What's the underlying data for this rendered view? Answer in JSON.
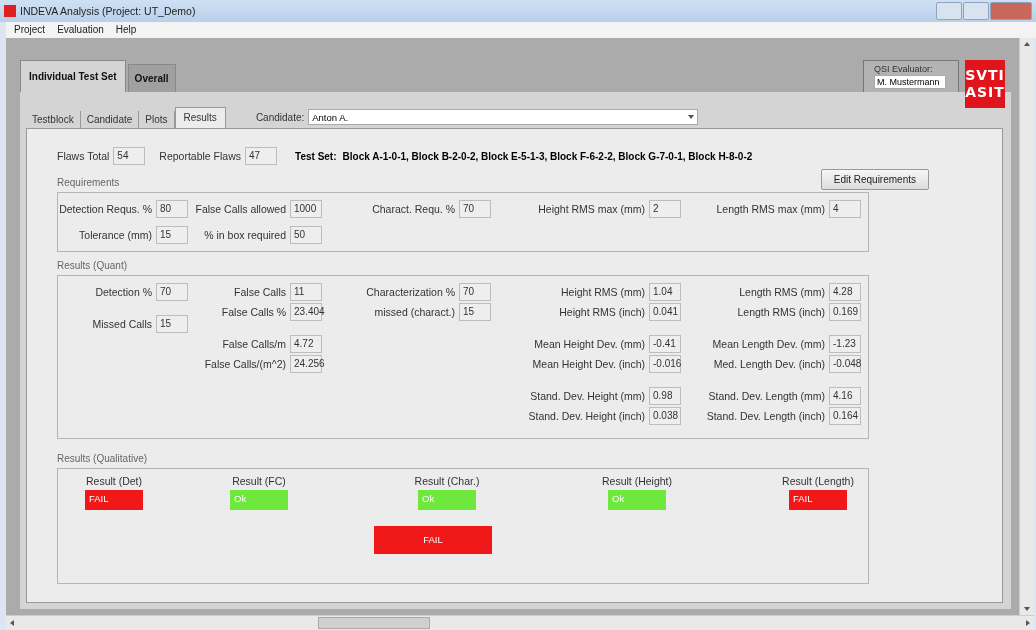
{
  "window": {
    "title": "INDEVA Analysis (Project: UT_Demo)"
  },
  "menu": [
    "Project",
    "Evaluation",
    "Help"
  ],
  "main_tabs": [
    {
      "label": "Individual Test Set",
      "selected": true
    },
    {
      "label": "Overall",
      "selected": false
    }
  ],
  "evaluator": {
    "label": "QSI Evaluator:",
    "value": "M. Mustermann"
  },
  "logo": [
    "SVTI",
    "ASIT"
  ],
  "sub_tabs": [
    {
      "label": "Testblock",
      "selected": false
    },
    {
      "label": "Candidate",
      "selected": false
    },
    {
      "label": "Plots",
      "selected": false
    },
    {
      "label": "Results",
      "selected": true
    }
  ],
  "candidate": {
    "label": "Candidate:",
    "value": "Anton A."
  },
  "flaws": [
    {
      "label": "Flaws Total",
      "value": "54"
    },
    {
      "label": "Reportable Flaws",
      "value": "47"
    }
  ],
  "test_set": {
    "label": "Test Set:",
    "value": "Block A-1-0-1, Block B-2-0-2, Block E-5-1-3, Block F-6-2-2, Block G-7-0-1, Block H-8-0-2"
  },
  "edit_button": "Edit Requirements",
  "requirements": {
    "title": "Requirements",
    "columns": [
      [
        [
          {
            "label": "Detection Requs. %",
            "value": "80"
          }
        ],
        [
          {
            "label": "Tolerance (mm)",
            "value": "15"
          }
        ]
      ],
      [
        [
          {
            "label": "False Calls  allowed",
            "value": "1000"
          }
        ],
        [
          {
            "label": "% in box required",
            "value": "50"
          }
        ]
      ],
      [
        [
          {
            "label": "Charact. Requ. %",
            "value": "70"
          }
        ]
      ],
      [
        [
          {
            "label": "Height RMS max (mm)",
            "value": "2"
          }
        ]
      ],
      [
        [
          {
            "label": "Length RMS max (mm)",
            "value": "4"
          }
        ]
      ]
    ]
  },
  "quant": {
    "title": "Results (Quant)",
    "columns": [
      [
        [
          {
            "label": "Detection %",
            "value": "70"
          }
        ],
        [
          {
            "label": "Missed Calls",
            "value": "15"
          }
        ]
      ],
      [
        [
          {
            "label": "False Calls",
            "value": "11"
          },
          {
            "label": "False Calls %",
            "value": "23.404"
          }
        ],
        [
          {
            "label": "False Calls/m",
            "value": "4.72"
          },
          {
            "label": "False Calls/(m^2)",
            "value": "24.256"
          }
        ]
      ],
      [
        [
          {
            "label": "Characterization %",
            "value": "70"
          },
          {
            "label": "missed (charact.)",
            "value": "15"
          }
        ]
      ],
      [
        [
          {
            "label": "Height RMS (mm)",
            "value": "1.04"
          },
          {
            "label": "Height RMS (inch)",
            "value": "0.041"
          }
        ],
        [
          {
            "label": "Mean Height Dev. (mm)",
            "value": "-0.41"
          },
          {
            "label": "Mean Height Dev. (inch)",
            "value": "-0.016"
          }
        ],
        [
          {
            "label": "Stand. Dev. Height (mm)",
            "value": "0.98"
          },
          {
            "label": "Stand. Dev. Height (inch)",
            "value": "0.038"
          }
        ]
      ],
      [
        [
          {
            "label": "Length RMS (mm)",
            "value": "4.28"
          },
          {
            "label": "Length RMS (inch)",
            "value": "0.169"
          }
        ],
        [
          {
            "label": "Mean Length Dev. (mm)",
            "value": "-1.23"
          },
          {
            "label": "Med. Length Dev. (inch)",
            "value": "-0.048"
          }
        ],
        [
          {
            "label": "Stand. Dev. Length (mm)",
            "value": "4.16"
          },
          {
            "label": "Stand. Dev. Length (inch)",
            "value": "0.164"
          }
        ]
      ]
    ]
  },
  "qualitative": {
    "title": "Results (Qualitative)",
    "results": [
      {
        "label": "Result (Det)",
        "value": "FAIL",
        "passed": false
      },
      {
        "label": "Result (FC)",
        "value": "Ok",
        "passed": true
      },
      {
        "label": "Result (Char.)",
        "value": "Ok",
        "passed": true
      },
      {
        "label": "Result (Height)",
        "value": "Ok",
        "passed": true
      },
      {
        "label": "Result (Length)",
        "value": "FAIL",
        "passed": false
      }
    ],
    "overall": {
      "value": "FAIL",
      "passed": false
    }
  }
}
